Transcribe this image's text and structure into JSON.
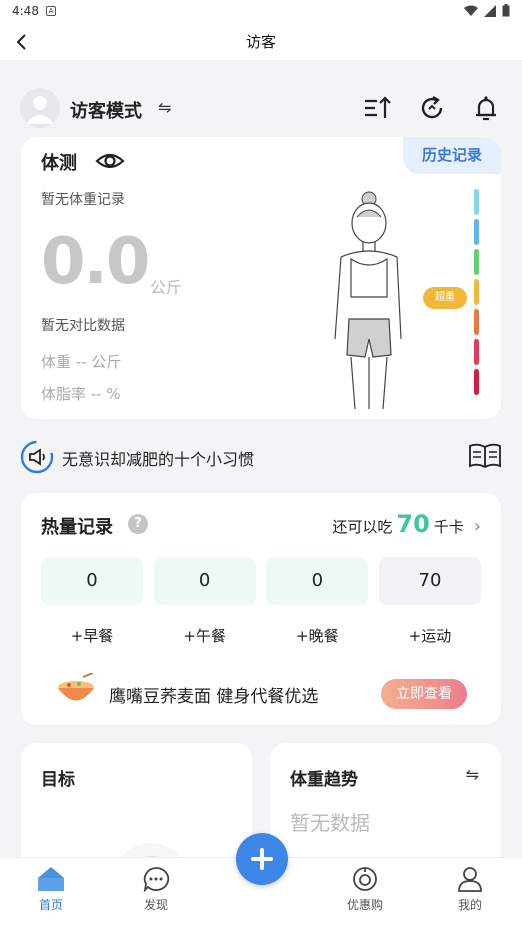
{
  "status": {
    "time": "4:48",
    "notif": "A"
  },
  "titlebar": {
    "title": "访客"
  },
  "user": {
    "name": "访客模式",
    "swap_icon": "⇋"
  },
  "body": {
    "title": "体测",
    "history": "历史记录",
    "no_weight": "暂无体重记录",
    "weight": "0.0",
    "unit": "公斤",
    "no_compare": "暂无对比数据",
    "weight_row": "体重 -- 公斤",
    "fat_row": "体脂率 -- %",
    "level": "超重",
    "scale_colors": [
      "#89d3f4",
      "#5cb6e6",
      "#64cf6e",
      "#f0b93b",
      "#e8774a",
      "#e23c58",
      "#d81b46"
    ]
  },
  "article": {
    "title": "无意识却减肥的十个小习惯"
  },
  "calories": {
    "title": "热量记录",
    "help": "?",
    "remain_prefix": "还可以吃",
    "remain_value": "70",
    "remain_unit": "千卡",
    "meals": [
      {
        "value": "0",
        "label": "+早餐"
      },
      {
        "value": "0",
        "label": "+午餐"
      },
      {
        "value": "0",
        "label": "+晚餐"
      },
      {
        "value": "70",
        "label": "+运动"
      }
    ],
    "ad_text": "鹰嘴豆荞麦面  健身代餐优选",
    "ad_button": "立即查看"
  },
  "goal": {
    "title": "目标"
  },
  "trend": {
    "title": "体重趋势",
    "swap": "⇋",
    "no_data": "暂无数据"
  },
  "nav": {
    "home": "首页",
    "discover": "发现",
    "deals": "优惠购",
    "mine": "我的"
  },
  "colors": {
    "accent": "#3b86e6",
    "green": "#3cc7a0"
  }
}
